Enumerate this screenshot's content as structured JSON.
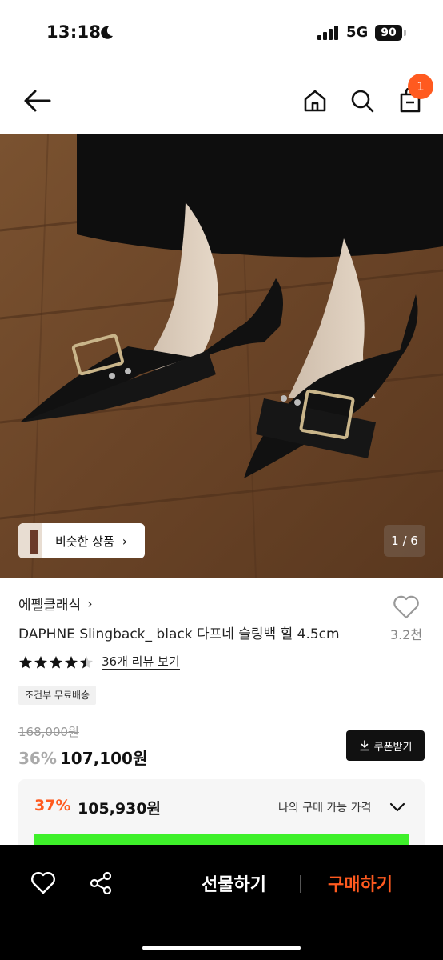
{
  "status": {
    "time": "13:18",
    "network": "5G",
    "battery": "90"
  },
  "nav": {
    "cart_count": "1"
  },
  "image": {
    "similar_label": "비슷한 상품",
    "pager": "1 / 6"
  },
  "product": {
    "brand": "에펠클래식",
    "title": "DAPHNE Slingback_ black 다프네 슬링백 힐 4.5cm",
    "like_count": "3.2천",
    "rating": 4.5,
    "review_link": "36개 리뷰 보기",
    "shipping_badge": "조건부 무료배송",
    "original_price": "168,000원",
    "sale_pct": "36%",
    "sale_price": "107,100원",
    "coupon_label": "쿠폰받기"
  },
  "my_price": {
    "pct": "37%",
    "price": "105,930원",
    "label": "나의 구매 가능 가격"
  },
  "bottom": {
    "gift_label": "선물하기",
    "buy_label": "구매하기"
  },
  "colors": {
    "accent": "#ff5a1f",
    "dark": "#000000"
  }
}
